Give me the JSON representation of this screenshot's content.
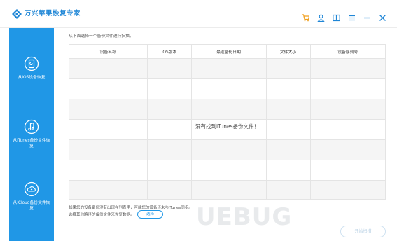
{
  "app": {
    "title": "万兴苹果恢复专家",
    "accent": "#2097e6",
    "title_color": "#1f86d6"
  },
  "titlebar_icons": [
    "cart-icon",
    "user-icon",
    "book-icon",
    "menu-icon",
    "minimize-icon",
    "close-icon"
  ],
  "sidebar": {
    "items": [
      {
        "label": "从iOS设备恢复",
        "icon": "ios-device-icon"
      },
      {
        "label": "从iTunes备份文件恢复",
        "icon": "itunes-icon"
      },
      {
        "label": "从iCloud备份文件恢复",
        "icon": "icloud-icon"
      }
    ]
  },
  "main": {
    "instruction": "从下面选择一个备份文件进行扫描。",
    "table": {
      "columns": [
        "设备名称",
        "iOS版本",
        "最近备份日期",
        "文件大小",
        "设备序列号"
      ],
      "empty_message": "没有找到iTunes备份文件！"
    },
    "footer_line1": "如果您的设备备份没有出现在列表里，可能您的设备还未与iTunes同步。",
    "footer_line2": "选择其他路径的备份文件来恢复数据。",
    "select_button": "选择",
    "start_button": "开始扫描"
  },
  "watermark": "UEBUG"
}
